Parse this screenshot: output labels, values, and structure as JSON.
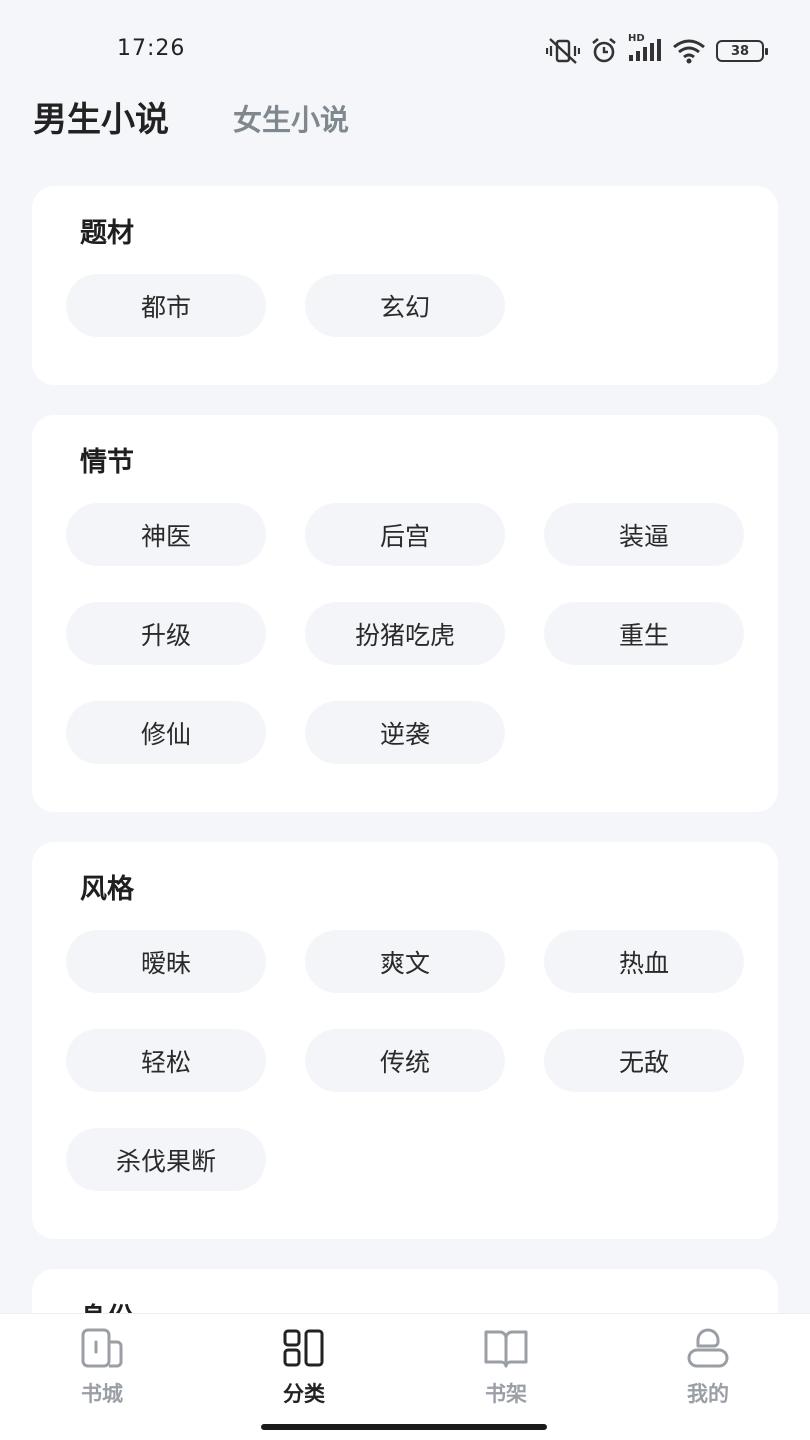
{
  "status_bar": {
    "time": "17:26",
    "battery": "38",
    "hd_label": "HD",
    "icons": [
      "vibrate-off-icon",
      "alarm-icon",
      "signal-icon",
      "wifi-icon",
      "battery-icon"
    ]
  },
  "top_tabs": [
    {
      "label": "男生小说",
      "active": true
    },
    {
      "label": "女生小说",
      "active": false
    }
  ],
  "sections": [
    {
      "title": "题材",
      "tags": [
        "都市",
        "玄幻"
      ]
    },
    {
      "title": "情节",
      "tags": [
        "神医",
        "后宫",
        "装逼",
        "升级",
        "扮猪吃虎",
        "重生",
        "修仙",
        "逆袭"
      ]
    },
    {
      "title": "风格",
      "tags": [
        "暧昧",
        "爽文",
        "热血",
        "轻松",
        "传统",
        "无敌",
        "杀伐果断"
      ]
    },
    {
      "title": "身份",
      "tags": []
    }
  ],
  "bottom_nav": [
    {
      "label": "书城",
      "icon": "bookstore-icon",
      "active": false
    },
    {
      "label": "分类",
      "icon": "category-icon",
      "active": true
    },
    {
      "label": "书架",
      "icon": "bookshelf-icon",
      "active": false
    },
    {
      "label": "我的",
      "icon": "profile-icon",
      "active": false
    }
  ],
  "colors": {
    "background": "#f5f6fa",
    "card": "#ffffff",
    "tag": "#f4f5f9",
    "active_text": "#222222",
    "inactive_text": "#9a9ea5"
  }
}
